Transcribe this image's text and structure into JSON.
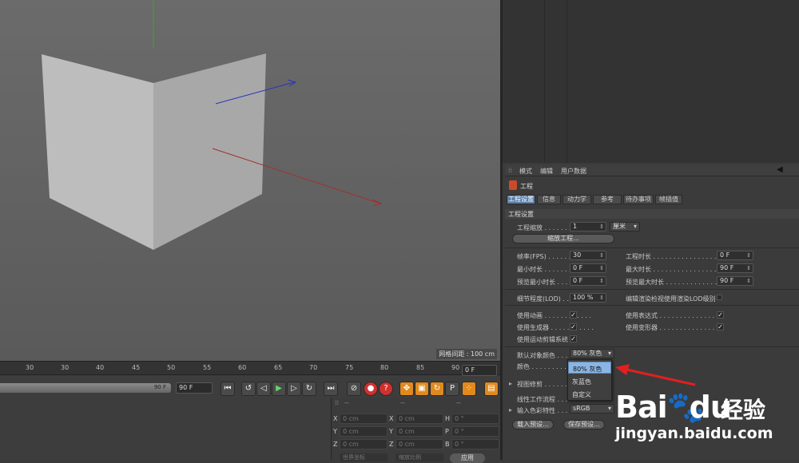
{
  "viewport": {
    "grid_info": "网格间距 : 100 cm"
  },
  "timeline": {
    "ticks": [
      "30",
      "40",
      "45",
      "50",
      "55",
      "60",
      "65",
      "70",
      "75",
      "80",
      "85",
      "90"
    ],
    "current_frame": "0 F",
    "range_end_bar": "90 F",
    "range_end_field": "90 F"
  },
  "coords": {
    "header_dots": [
      "--",
      "--",
      "--"
    ],
    "rows": [
      {
        "a": "X",
        "av": "0 cm",
        "b": "X",
        "bv": "0 cm",
        "c": "H",
        "cv": "0 °"
      },
      {
        "a": "Y",
        "av": "0 cm",
        "b": "Y",
        "bv": "0 cm",
        "c": "P",
        "cv": "0 °"
      },
      {
        "a": "Z",
        "av": "0 cm",
        "b": "Z",
        "bv": "0 cm",
        "c": "B",
        "cv": "0 °"
      }
    ],
    "mode1": "世界坐标",
    "mode2": "缩放比例",
    "apply": "应用"
  },
  "attributes": {
    "menu": [
      "模式",
      "编辑",
      "用户数据"
    ],
    "project_title": "工程",
    "tabs": [
      "工程设置",
      "信息",
      "动力学",
      "参考",
      "待办事项",
      "帧插值"
    ],
    "section": "工程设置",
    "project_scale_label": "工程缩放 . . . . . . . .",
    "project_scale_value": "1",
    "project_scale_unit": "厘米",
    "scale_project_button": "缩放工程...",
    "fps_label": "帧率(FPS) . . . . . . .",
    "fps_value": "30",
    "project_time_label": "工程时长 . . . . . . . . . . . . . . . . .",
    "project_time_value": "0 F",
    "min_time_label": "最小时长 . . . . . . .",
    "min_time_value": "0 F",
    "max_time_label": "最大时长 . . . . . . . . . . . . . . . . .",
    "max_time_value": "90 F",
    "preview_min_label": "预览最小时长 . . .",
    "preview_min_value": "0 F",
    "preview_max_label": "预览最大时长 . . . . . . . . . . . . .",
    "preview_max_value": "90 F",
    "lod_label": "细节程度(LOD) . .",
    "lod_value": "100 %",
    "lod_render_label": "编辑渲染检视使用渲染LOD级别",
    "use_anim_label": "使用动画 . . . . . . . . . . . .",
    "use_expr_label": "使用表达式 . . . . . . . . . . . . . . .",
    "use_gen_label": "使用生成器 . . . . . . . . . . .",
    "use_deform_label": "使用变形器 . . . . . . . . . . . . . . .",
    "use_motion_label": "使用运动剪辑系统",
    "default_color_label": "默认对象颜色 . . .",
    "default_color_value": "80% 灰色",
    "color_label": "颜色 . . . . . . . . . . .",
    "view_clip_label": "视图修剪 . . . . . . .",
    "linear_workflow_label": "线性工作流程 . . .",
    "input_color_label": "输入色彩特性 . . .",
    "input_color_value": "sRGB",
    "load_preset": "载入预设...",
    "save_preset": "保存预设...",
    "popup_items": [
      "80% 灰色",
      "灰蓝色",
      "自定义"
    ]
  },
  "watermark": {
    "bai": "Bai",
    "du": "du",
    "cn": "经验",
    "url": "jingyan.baidu.com"
  },
  "colors": {
    "arrow": "#e02020",
    "highlight": "#8bb6e3",
    "axis_x": "#b03030",
    "axis_y": "#40a040",
    "axis_z": "#3040c0"
  }
}
